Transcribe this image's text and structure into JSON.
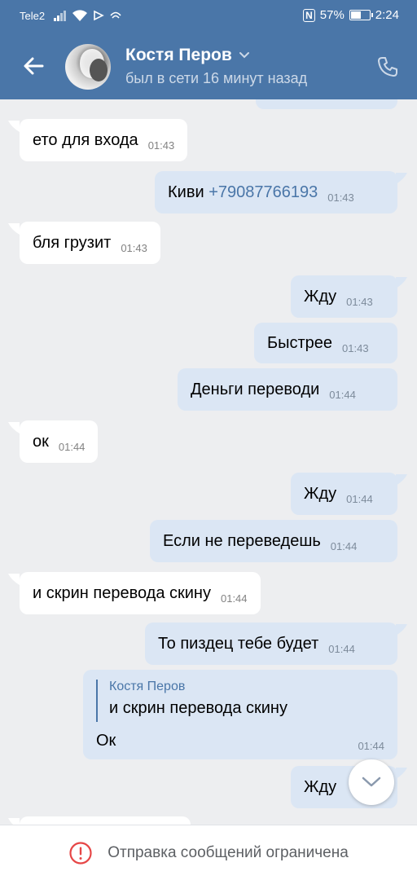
{
  "status_bar": {
    "carrier": "Tele2",
    "nfc": "N",
    "battery_percent": "57%",
    "battery_level": 0.57,
    "time": "2:24"
  },
  "header": {
    "contact_name": "Костя Перов",
    "last_seen": "был в сети 16 минут назад",
    "icons": [
      "back-arrow-icon",
      "chevron-down-icon",
      "phone-icon"
    ]
  },
  "messages": [
    {
      "dir": "in",
      "text": "ето для входа",
      "time": "01:43"
    },
    {
      "dir": "out",
      "text": "Киви ",
      "link": "+79087766193",
      "time": "01:43"
    },
    {
      "dir": "in",
      "text": "бля грузит",
      "time": "01:43"
    },
    {
      "dir": "out",
      "text": "Жду",
      "time": "01:43"
    },
    {
      "dir": "out",
      "text": "Быстрее",
      "time": "01:43"
    },
    {
      "dir": "out",
      "text": "Деньги переводи",
      "time": "01:44"
    },
    {
      "dir": "in",
      "text": "ок",
      "time": "01:44"
    },
    {
      "dir": "out",
      "text": "Жду",
      "time": "01:44"
    },
    {
      "dir": "out",
      "text": "Если не переведешь",
      "time": "01:44"
    },
    {
      "dir": "in",
      "text": "и скрин перевода скину",
      "time": "01:44"
    },
    {
      "dir": "out",
      "text": "То пиздец тебе будет",
      "time": "01:44"
    },
    {
      "dir": "out",
      "text": "Жду",
      "time": ""
    }
  ],
  "reply": {
    "quoted_name": "Костя Перов",
    "quoted_text": "и скрин перевода скину",
    "text": "Ок",
    "time": "01:44"
  },
  "footer": {
    "notice": "Отправка сообщений ограничена",
    "icon": "warning-circle-icon",
    "icon_color": "#e64646"
  },
  "colors": {
    "header_bg": "#4a76a8",
    "incoming_bubble": "#ffffff",
    "outgoing_bubble": "#dbe6f4",
    "chat_bg": "#edeef0",
    "link": "#4a76a8"
  }
}
